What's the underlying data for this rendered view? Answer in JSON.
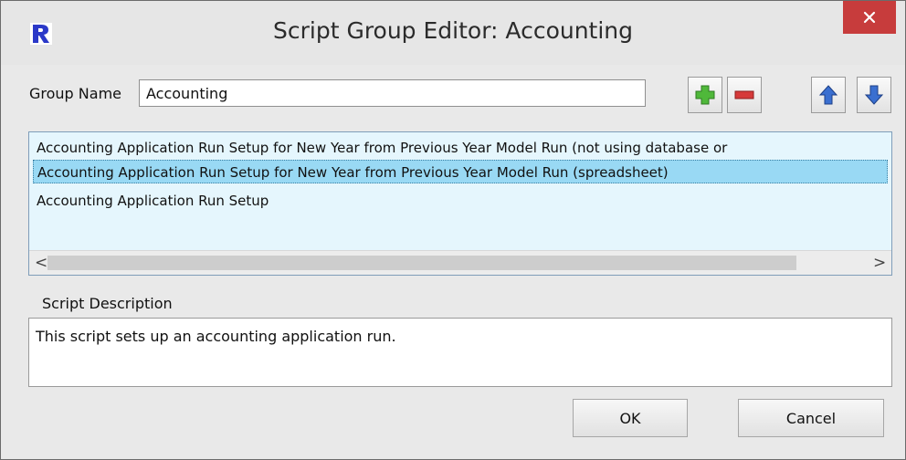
{
  "window": {
    "title": "Script Group Editor: Accounting",
    "app_icon": "riverware-r-icon",
    "close_icon": "close-icon"
  },
  "group": {
    "label": "Group Name",
    "value": "Accounting"
  },
  "toolbar": {
    "add_icon": "plus-icon",
    "remove_icon": "minus-icon",
    "up_icon": "arrow-up-icon",
    "down_icon": "arrow-down-icon"
  },
  "scripts": {
    "items": [
      "Accounting Application Run Setup for New Year from Previous Year Model Run (not using database or",
      "Accounting Application Run Setup for New Year from Previous Year Model Run (spreadsheet)",
      "Accounting Application Run Setup"
    ],
    "selected_index": 1,
    "scroll_left": "<",
    "scroll_right": ">"
  },
  "description": {
    "label": "Script Description",
    "text": "This script sets up an accounting application run."
  },
  "buttons": {
    "ok": "OK",
    "cancel": "Cancel"
  }
}
